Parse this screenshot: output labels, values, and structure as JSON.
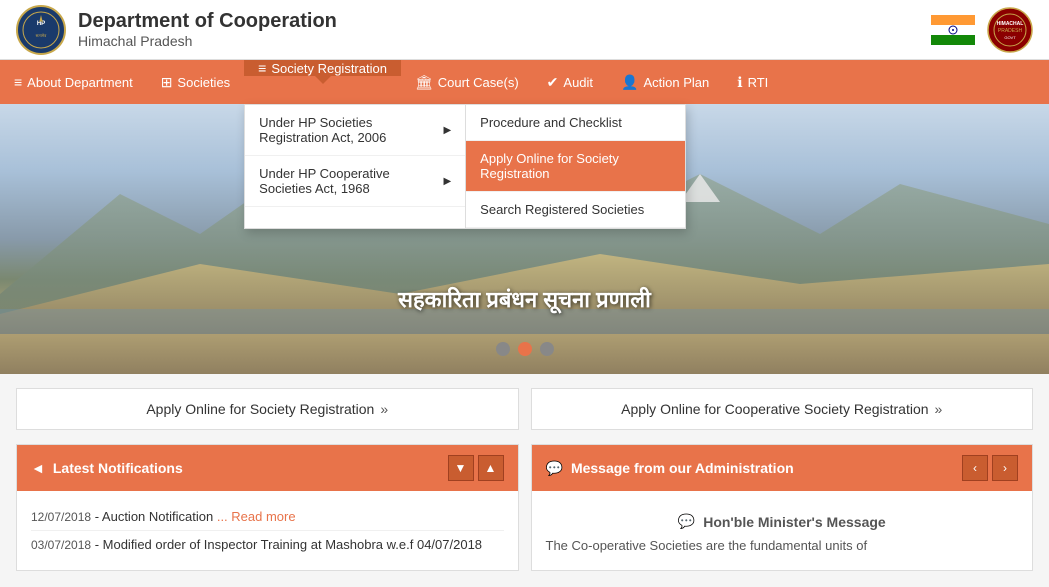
{
  "header": {
    "dept_name": "Department of Cooperation",
    "state_name": "Himachal Pradesh"
  },
  "navbar": {
    "items": [
      {
        "id": "about",
        "label": "About Department",
        "icon": "≡"
      },
      {
        "id": "societies",
        "label": "Societies",
        "icon": "⊞"
      },
      {
        "id": "society-reg",
        "label": "Society Registration",
        "icon": "≡",
        "active": true
      },
      {
        "id": "court-cases",
        "label": "Court Case(s)",
        "icon": "🏛"
      },
      {
        "id": "audit",
        "label": "Audit",
        "icon": "✔"
      },
      {
        "id": "action-plan",
        "label": "Action Plan",
        "icon": "👤"
      },
      {
        "id": "rti",
        "label": "RTI",
        "icon": "ℹ"
      }
    ]
  },
  "dropdown": {
    "col1": [
      {
        "label": "Under HP Societies Registration Act, 2006",
        "has_sub": true,
        "active": false
      },
      {
        "label": "Under HP Cooperative Societies Act, 1968",
        "has_sub": true,
        "active": false
      }
    ],
    "col2": [
      {
        "label": "Procedure and Checklist"
      },
      {
        "label": "Apply Online for Society Registration"
      },
      {
        "label": "Search Registered Societies"
      }
    ]
  },
  "hero": {
    "text": "सहकारिता प्रबंधन सूचना प्रणाली",
    "dots": [
      {
        "active": false
      },
      {
        "active": true
      },
      {
        "active": false
      }
    ]
  },
  "quick_links": [
    {
      "label": "Apply Online for Society Registration",
      "arrow": "»"
    },
    {
      "label": "Apply Online for Cooperative Society Registration",
      "arrow": "»"
    }
  ],
  "panels": {
    "notifications": {
      "title": "Latest Notifications",
      "title_icon": "◄",
      "controls": [
        "▼",
        "▲"
      ],
      "items": [
        {
          "date": "12/07/2018",
          "text": "Auction Notification",
          "read_more": "... Read more"
        },
        {
          "date": "03/07/2018",
          "text": "Modified order of Inspector Training at Mashobra w.e.f 04/07/2018",
          "read_more": ""
        }
      ]
    },
    "message": {
      "title": "Message from our Administration",
      "title_icon": "💬",
      "controls": [
        "‹",
        "›"
      ],
      "msg_title_icon": "💬",
      "msg_title": "Hon'ble Minister's Message",
      "msg_content": "The Co-operative Societies are the fundamental units of"
    }
  }
}
